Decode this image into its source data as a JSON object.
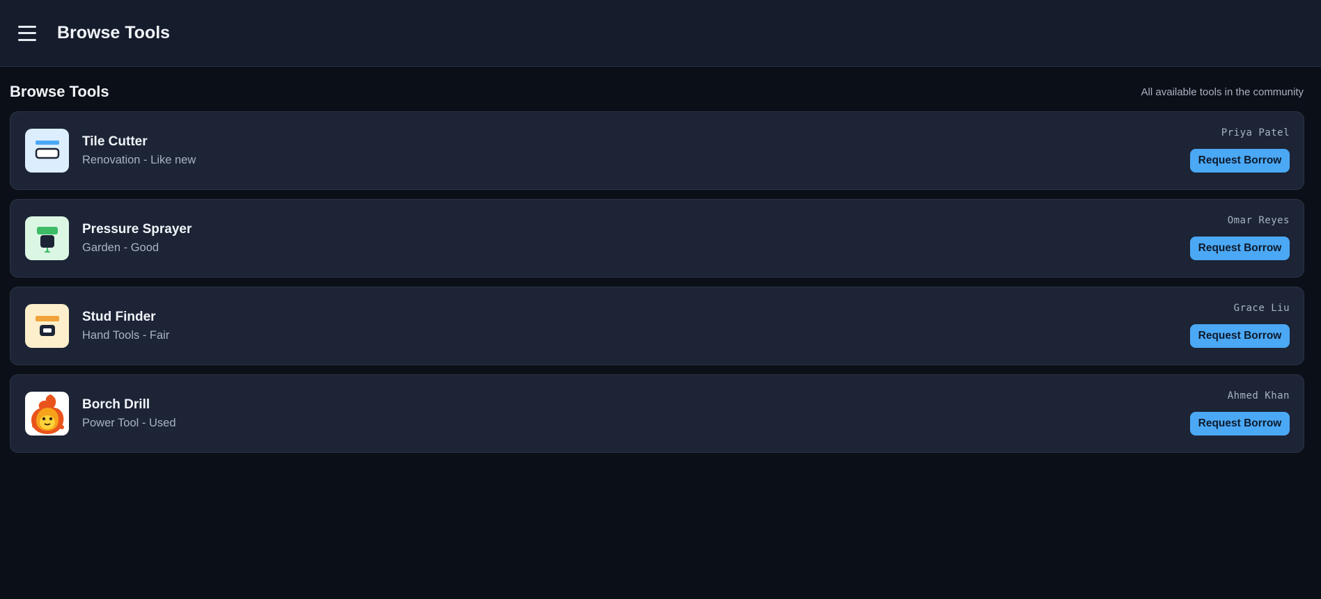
{
  "header": {
    "title": "Browse Tools",
    "menu_icon": "hamburger-icon"
  },
  "section": {
    "title": "Browse Tools",
    "subtitle": "All available tools in the community"
  },
  "tools": [
    {
      "name": "Tile Cutter",
      "meta": "Renovation - Like new",
      "owner": "Priya Patel",
      "action": "Request Borrow",
      "icon": "tile-cutter-icon",
      "accent": "#4ba8f5",
      "thumb_bg": "#dceefe"
    },
    {
      "name": "Pressure Sprayer",
      "meta": "Garden - Good",
      "owner": "Omar Reyes",
      "action": "Request Borrow",
      "icon": "pressure-sprayer-icon",
      "accent": "#3dbb67",
      "thumb_bg": "#dcf6e4"
    },
    {
      "name": "Stud Finder",
      "meta": "Hand Tools - Fair",
      "owner": "Grace Liu",
      "action": "Request Borrow",
      "icon": "stud-finder-icon",
      "accent": "#f0a43a",
      "thumb_bg": "#feefcc"
    },
    {
      "name": "Borch Drill",
      "meta": "Power Tool - Used",
      "owner": "Ahmed Khan",
      "action": "Request Borrow",
      "icon": "fire-creature-icon",
      "accent": "#f0631a",
      "thumb_bg": "#ffffff"
    }
  ],
  "colors": {
    "background": "#0b0f17",
    "header": "#151c2b",
    "card": "#1c2435",
    "button": "#4ba8f5"
  }
}
